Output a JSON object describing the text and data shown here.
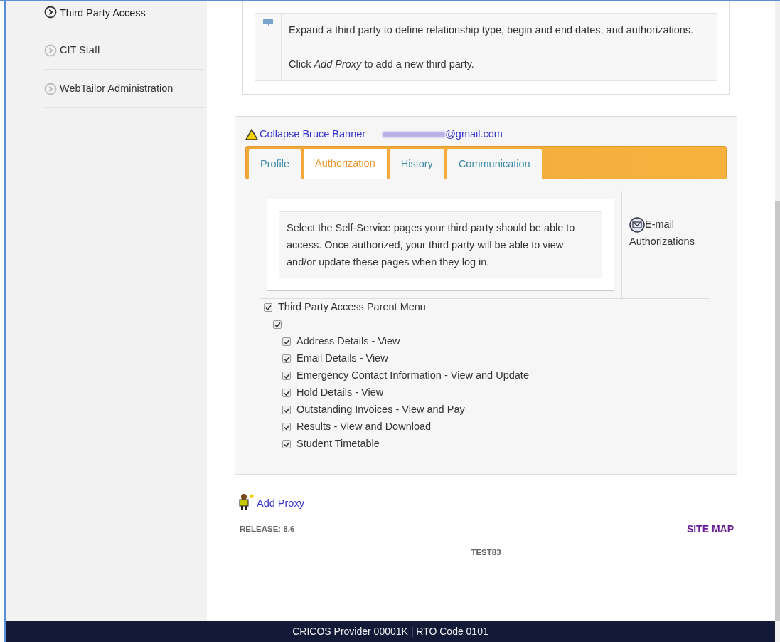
{
  "sidebar": {
    "items": [
      {
        "label": "Third Party Access",
        "selected": true
      },
      {
        "label": "CIT Staff",
        "selected": false
      },
      {
        "label": "WebTailor Administration",
        "selected": false
      }
    ]
  },
  "info": {
    "lines": [
      "Expand a third party to define relationship type, begin and end dates, and authorizations.",
      "Click *Add Proxy* to add a new third party."
    ]
  },
  "proxy": {
    "collapse_link": "Collapse Bruce Banner",
    "email": "@gmail.com",
    "tabs": [
      {
        "label": "Profile",
        "selected": false
      },
      {
        "label": "Authorization",
        "selected": true
      },
      {
        "label": "History",
        "selected": false
      },
      {
        "label": "Communication",
        "selected": false
      }
    ],
    "instructions": "Select the Self-Service pages your third party should be able to access. Once authorized, your third party will be able to view and/or update these pages when they log in.",
    "email_link": "E-mail",
    "email_link_2": "Authorizations",
    "menu": [
      {
        "label": "Third Party Access Parent Menu",
        "checked": true,
        "children": [
          {
            "checked": true,
            "children": [
              {
                "label": "Address Details - View",
                "checked": true
              },
              {
                "label": "Email Details - View",
                "checked": true
              },
              {
                "label": "Emergency Contact Information - View and Update",
                "checked": true
              },
              {
                "label": "Hold Details - View",
                "checked": true
              },
              {
                "label": "Outstanding Invoices - View and Pay",
                "checked": true
              },
              {
                "label": "Results - View and Download",
                "checked": true
              },
              {
                "label": "Student Timetable",
                "checked": true
              }
            ]
          }
        ]
      }
    ]
  },
  "add_proxy": "Add Proxy",
  "release": "RELEASE: 8.6",
  "site_map": "SITE MAP",
  "instance": "TEST83",
  "footer": "CRICOS Provider 00001K | RTO Code 0101"
}
